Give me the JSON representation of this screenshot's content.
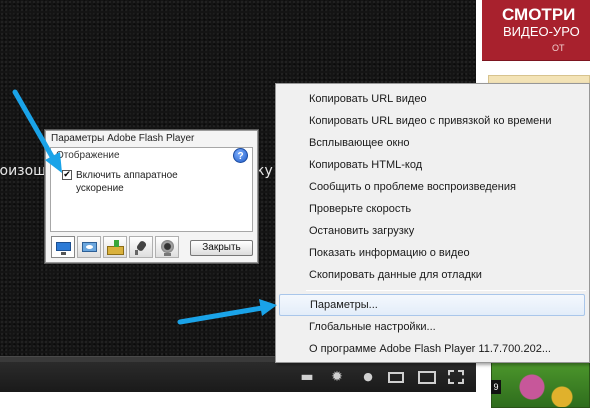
{
  "video": {
    "caption_left": "роизош",
    "caption_right": "ку"
  },
  "player_controls": [
    {
      "name": "annotations-icon",
      "glyph": "▬"
    },
    {
      "name": "gear-icon",
      "glyph": "✹"
    },
    {
      "name": "info-icon",
      "glyph": "●"
    }
  ],
  "flash_dialog": {
    "title": "Параметры Adobe Flash Player",
    "section": "Отображение",
    "help_glyph": "?",
    "checkbox_checked": true,
    "checkbox_label": "Включить аппаратное ускорение",
    "close_label": "Закрыть",
    "tabs": [
      "display-icon",
      "privacy-icon",
      "storage-icon",
      "microphone-icon",
      "camera-icon"
    ]
  },
  "context_menu": {
    "items": [
      "Копировать URL видео",
      "Копировать URL видео с привязкой ко времени",
      "Всплывающее окно",
      "Копировать HTML-код",
      "Сообщить о проблеме воспроизведения",
      "Проверьте скорость",
      "Остановить загрузку",
      "Показать информацию о видео",
      "Скопировать данные для отладки"
    ],
    "settings_label": "Параметры...",
    "global_settings_label": "Глобальные настройки...",
    "about_label": "О программе Adobe Flash Player 11.7.700.202..."
  },
  "ad": {
    "line1": "СМОТРИ",
    "line2": "ВИДЕО-УРО",
    "line3": "ОТ",
    "badge": "9"
  },
  "colors": {
    "arrow": "#1aa3e8",
    "ad_red": "#a8212d",
    "video_bg": "#141414",
    "menu_bg": "#f0f0f0",
    "menu_highlight": "#e3edf9"
  }
}
